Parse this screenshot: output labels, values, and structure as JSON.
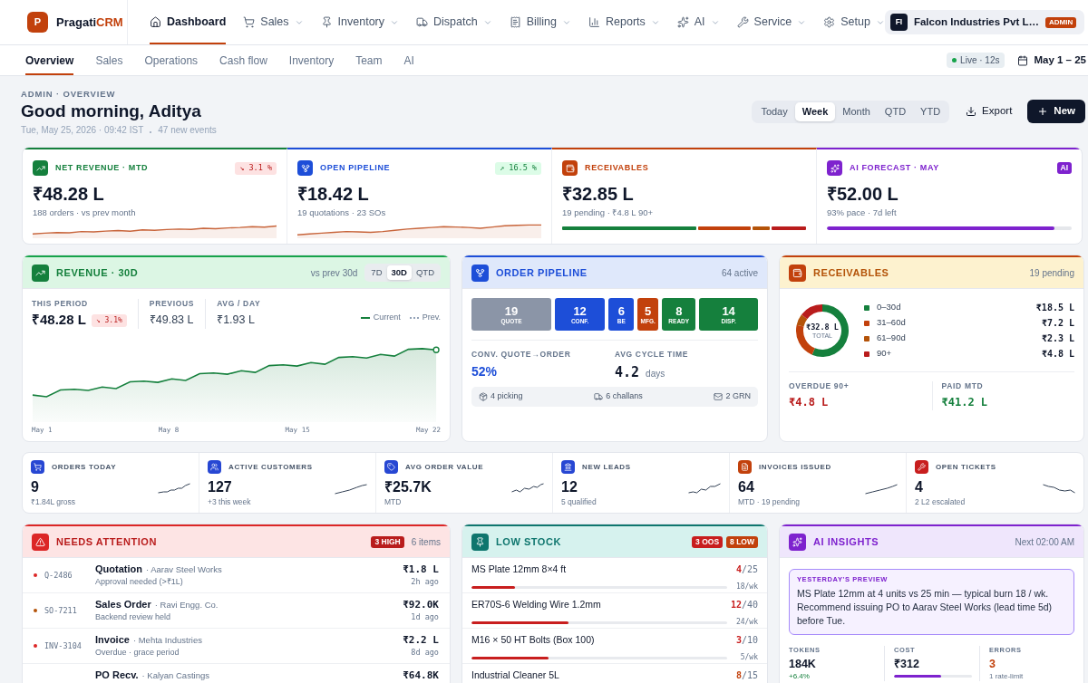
{
  "brand": {
    "logo": "P",
    "name": "Pragati",
    "accent": "CRM"
  },
  "nav": [
    {
      "label": "Dashboard",
      "selected": true,
      "dropdown": false
    },
    {
      "label": "Sales",
      "selected": false,
      "dropdown": true
    },
    {
      "label": "Inventory",
      "selected": false,
      "dropdown": true
    },
    {
      "label": "Dispatch",
      "selected": false,
      "dropdown": true
    },
    {
      "label": "Billing",
      "selected": false,
      "dropdown": true
    },
    {
      "label": "Reports",
      "selected": false,
      "dropdown": true
    },
    {
      "label": "AI",
      "selected": false,
      "dropdown": true
    },
    {
      "label": "Service",
      "selected": false,
      "dropdown": true
    },
    {
      "label": "Setup",
      "selected": false,
      "dropdown": true
    }
  ],
  "org": {
    "initials": "FI",
    "name": "Falcon Industries Pvt L…",
    "role": "ADMIN"
  },
  "subnav": {
    "tabs": [
      {
        "label": "Overview",
        "selected": true
      },
      {
        "label": "Sales",
        "selected": false
      },
      {
        "label": "Operations",
        "selected": false
      },
      {
        "label": "Cash flow",
        "selected": false
      },
      {
        "label": "Inventory",
        "selected": false
      },
      {
        "label": "Team",
        "selected": false
      },
      {
        "label": "AI",
        "selected": false
      }
    ],
    "live": "Live · 12s",
    "date_range": "May 1 – 25"
  },
  "header": {
    "eyebrow": "ADMIN · OVERVIEW",
    "greeting": "Good morning, Aditya",
    "timestamp": "Tue, May 25, 2026 · 09:42 IST",
    "events": "47 new events",
    "periods": [
      {
        "label": "Today",
        "selected": false
      },
      {
        "label": "Week",
        "selected": true
      },
      {
        "label": "Month",
        "selected": false
      },
      {
        "label": "QTD",
        "selected": false
      },
      {
        "label": "YTD",
        "selected": false
      }
    ],
    "export": "Export",
    "new": "New"
  },
  "kpis": [
    {
      "title": "NET REVENUE · MTD",
      "color": "#15803d",
      "delta": {
        "text": "↘ 3.1 %",
        "up": false
      },
      "value": "₹48.28 L",
      "sub": "188 orders · vs prev month",
      "kind": "sparkline"
    },
    {
      "title": "OPEN PIPELINE",
      "color": "#1d4ed8",
      "delta": {
        "text": "↗ 16.5 %",
        "up": true
      },
      "value": "₹18.42 L",
      "sub": "19 quotations · 23 SOs",
      "kind": "sparkline"
    },
    {
      "title": "RECEIVABLES",
      "color": "#c2410c",
      "value": "₹32.85 L",
      "sub": "19 pending · ₹4.8 L 90+",
      "kind": "segments"
    },
    {
      "title": "AI FORECAST · MAY",
      "color": "#7e22ce",
      "badge": "AI",
      "value": "₹52.00 L",
      "sub": "93% pace · 7d left",
      "kind": "progress",
      "level": 0.93
    }
  ],
  "revenue": {
    "title": "REVENUE · 30D",
    "compare": "vs prev 30d",
    "ranges": [
      {
        "label": "7D",
        "selected": false
      },
      {
        "label": "30D",
        "selected": true
      },
      {
        "label": "QTD",
        "selected": false
      }
    ],
    "stats": [
      {
        "label": "THIS PERIOD",
        "value": "₹48.28 L",
        "delta": {
          "text": "↘ 3.1%",
          "up": false
        }
      },
      {
        "label": "PREVIOUS",
        "value": "₹49.83 L"
      },
      {
        "label": "AVG / DAY",
        "value": "₹1.93 L"
      }
    ],
    "legend": [
      {
        "label": "Current",
        "kind": "solid"
      },
      {
        "label": "Prev.",
        "kind": "dashed"
      }
    ],
    "x_labels": [
      "May 1",
      "May 8",
      "May 15",
      "May 22"
    ]
  },
  "pipeline": {
    "title": "ORDER PIPELINE",
    "count": "64 active",
    "stages": [
      {
        "count": "19",
        "label": "QUOTE",
        "color": "#8b95a7"
      },
      {
        "count": "12",
        "label": "CONF.",
        "color": "#1d4ed8"
      },
      {
        "count": "6",
        "label": "BE",
        "color": "#1d4ed8"
      },
      {
        "count": "5",
        "label": "MFG.",
        "color": "#c2410c"
      },
      {
        "count": "8",
        "label": "READY",
        "color": "#15803d"
      },
      {
        "count": "14",
        "label": "DISP.",
        "color": "#15803d"
      }
    ],
    "metrics": [
      {
        "label": "CONV. QUOTE→ORDER",
        "value": "52%"
      },
      {
        "label": "AVG CYCLE TIME",
        "value": "4.2",
        "unit": "days"
      }
    ],
    "footer": [
      "4 picking",
      "6 challans",
      "2 GRN"
    ]
  },
  "receivables": {
    "title": "RECEIVABLES",
    "count": "19 pending",
    "chart_data": {
      "type": "donut",
      "categories": [
        "0–30d",
        "31–60d",
        "61–90d",
        "90+"
      ],
      "values": [
        56.4,
        22.0,
        7.0,
        14.6
      ]
    },
    "center_value": "₹32.8 L",
    "center_label": "TOTAL",
    "legend": [
      {
        "amount": "₹18.5 L",
        "color": "#15803d"
      },
      {
        "amount": "₹7.2 L",
        "color": "#c2410c"
      },
      {
        "amount": "₹2.3 L",
        "color": "#b45309"
      },
      {
        "amount": "₹4.8 L",
        "color": "#b91c1c"
      }
    ],
    "overdue": {
      "label": "OVERDUE 90+",
      "value": "₹4.8 L"
    },
    "paid": {
      "label": "PAID MTD",
      "value": "₹41.2 L"
    }
  },
  "stats": [
    {
      "label": "ORDERS TODAY",
      "value": "9",
      "sub": "₹1.84L gross",
      "color": "#2747d3"
    },
    {
      "label": "ACTIVE CUSTOMERS",
      "value": "127",
      "sub": "+3 this week",
      "color": "#2747d3"
    },
    {
      "label": "AVG ORDER VALUE",
      "value": "₹25.7K",
      "sub": "MTD",
      "color": "#2747d3"
    },
    {
      "label": "NEW LEADS",
      "value": "12",
      "sub": "5 qualified",
      "color": "#2747d3"
    },
    {
      "label": "INVOICES ISSUED",
      "value": "64",
      "sub": "MTD · 19 pending",
      "color": "#c2410c"
    },
    {
      "label": "OPEN TICKETS",
      "value": "4",
      "sub": "2 L2 escalated",
      "color": "#c81e1e"
    }
  ],
  "attention": {
    "title": "NEEDS ATTENTION",
    "badge": "3 HIGH",
    "count": "6 items",
    "items": [
      {
        "id": "Q-2486",
        "type": "Quotation",
        "party": "· Aarav Steel Works",
        "note": "Approval needed (>₹1L)",
        "amount": "₹1.8 L",
        "age": "2h ago",
        "color": "#dc2626"
      },
      {
        "id": "SO-7211",
        "type": "Sales Order",
        "party": "· Ravi Engg. Co.",
        "note": "Backend review held",
        "amount": "₹92.0K",
        "age": "1d ago",
        "color": "#b45309"
      },
      {
        "id": "INV-3104",
        "type": "Invoice",
        "party": "· Mehta Industries",
        "note": "Overdue · grace period",
        "amount": "₹2.2 L",
        "age": "8d ago",
        "color": "#dc2626"
      },
      {
        "type": "PO Recv.",
        "party": "· Kalyan Castings",
        "amount": "₹64.8K"
      }
    ]
  },
  "low_stock": {
    "title": "LOW STOCK",
    "badges": [
      {
        "text": "3 OOS",
        "color": "#c81e1e"
      },
      {
        "text": "8 LOW",
        "color": "#c2410c"
      }
    ],
    "items": [
      {
        "name": "MS Plate 12mm 8×4 ft",
        "qty": "4",
        "cap": "/25",
        "level": 0.17,
        "rate": "18/wk",
        "color": "#c81e1e"
      },
      {
        "name": "ER70S-6 Welding Wire 1.2mm",
        "qty": "12",
        "cap": "/40",
        "level": 0.38,
        "rate": "24/wk",
        "color": "#c81e1e"
      },
      {
        "name": "M16 × 50 HT Bolts (Box 100)",
        "qty": "3",
        "cap": "/10",
        "level": 0.3,
        "rate": "5/wk",
        "color": "#c81e1e"
      },
      {
        "name": "Industrial Cleaner 5L",
        "qty": "8",
        "cap": "/15",
        "color": "#c2410c"
      }
    ]
  },
  "ai_insights": {
    "title": "AI INSIGHTS",
    "next": "Next 02:00 AM",
    "preview": {
      "label": "YESTERDAY'S PREVIEW",
      "text": "MS Plate 12mm at 4 units vs 25 min — typical burn 18 / wk. Recommend issuing PO to Aarav Steel Works (lead time 5d) before Tue."
    },
    "metrics": [
      {
        "label": "TOKENS",
        "value": "184K",
        "sub": "+6.4%",
        "kind": "delta"
      },
      {
        "label": "COST",
        "value": "₹312",
        "kind": "bar",
        "level": 0.6
      },
      {
        "label": "ERRORS",
        "value": "3",
        "sub": "1 rate-limit",
        "kind": "count"
      }
    ]
  }
}
